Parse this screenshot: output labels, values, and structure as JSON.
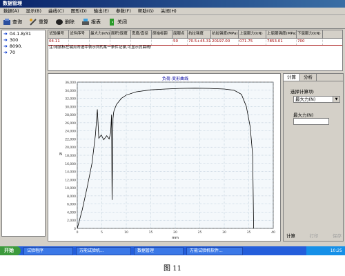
{
  "window": {
    "title": "数据管理"
  },
  "menu": [
    "数据(A)",
    "显示(B)",
    "曲线(C)",
    "图形(D)",
    "输出(E)",
    "参数(F)",
    "帮助(G)",
    "关闭(H)"
  ],
  "toolbar": [
    {
      "label": "查询",
      "icon": "search-icon"
    },
    {
      "label": "重算",
      "icon": "recalc-icon"
    },
    {
      "label": "删除",
      "icon": "delete-icon"
    },
    {
      "label": "报表",
      "icon": "report-icon"
    },
    {
      "label": "关闭",
      "icon": "exit-icon"
    }
  ],
  "tree": [
    "04.1.8/31",
    "300",
    "8090.",
    "70"
  ],
  "table": {
    "headers": [
      "试验编号",
      "试件序号",
      "最大力(kN)",
      "面积/厚度",
      "宽度/直径",
      "原始标距",
      "屈服点",
      "抗拉强度",
      "抗拉强度(MPa)",
      "上屈服力(kN)",
      "上屈服强度(MPa)",
      "下屈服力(kN)"
    ],
    "row": [
      "04.11",
      "",
      "",
      "",
      "",
      "",
      "50",
      "70.5+45.31",
      "20197.00",
      "071.75",
      "7853.01",
      "700"
    ],
    "note": "注:用鼠标左键点击选中表示列的某一条件记录,可显示其曲线!"
  },
  "chart_data": {
    "type": "line",
    "title": "负荷-变形曲线",
    "xlabel": "mm",
    "ylabel": "N",
    "xlim": [
      0,
      40
    ],
    "ylim": [
      0,
      36000
    ],
    "xticks": [
      0,
      5,
      10,
      15,
      20,
      25,
      30,
      35,
      40
    ],
    "yticks": [
      0,
      2000,
      4000,
      6000,
      8000,
      10000,
      12000,
      14000,
      16000,
      18000,
      20000,
      22000,
      24000,
      26000,
      28000,
      30000,
      32000,
      34000,
      36000
    ],
    "grid": true,
    "series": [
      {
        "x": [
          0,
          1,
          2,
          3,
          3.7,
          4.1,
          4.4,
          4.9,
          5.4,
          6.0,
          6.5,
          6.8,
          7.0,
          7.1,
          7.3,
          7.4,
          7.5,
          8,
          9,
          10,
          12,
          15,
          18,
          21,
          24,
          27,
          30,
          32,
          33.5,
          34.5,
          35.3,
          35.8,
          36
        ],
        "y": [
          0,
          4500,
          10000,
          16000,
          23000,
          29300,
          22200,
          23000,
          21800,
          22800,
          22000,
          23500,
          28000,
          7000,
          27000,
          28300,
          29000,
          30500,
          32000,
          32800,
          33600,
          34100,
          34300,
          34450,
          34500,
          34450,
          34300,
          34000,
          33000,
          30000,
          25000,
          18000,
          0
        ]
      }
    ]
  },
  "side": {
    "tabs": [
      "计算",
      "分析"
    ],
    "select_label": "选择计算项:",
    "select_value": "最大力(N)",
    "field_label": "最大力(N)",
    "buttons": [
      "计算",
      "打印",
      "保存"
    ]
  },
  "taskbar": {
    "start": "开始",
    "tasks": [
      "试验程序",
      "万能试验机...",
      "数据管理",
      "万能试验机软件..."
    ],
    "clock": "10:25"
  },
  "caption": "图 11"
}
